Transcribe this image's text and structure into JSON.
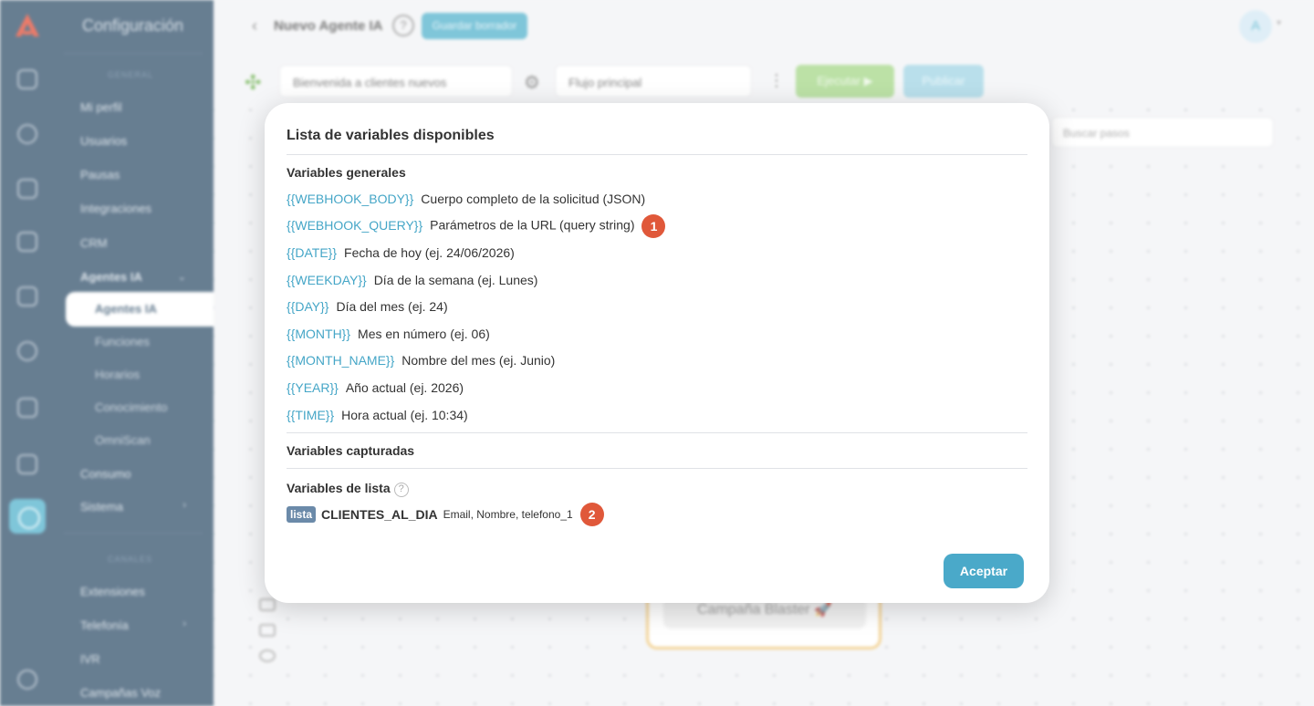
{
  "sidebar": {
    "title": "Configuración",
    "section_general": "GENERAL",
    "items": [
      "Mi perfil",
      "Usuarios",
      "Pausas",
      "Integraciones",
      "CRM"
    ],
    "agents_group": "Agentes IA",
    "agents_sub": [
      "Agentes IA",
      "Funciones",
      "Horarios",
      "Conocimiento",
      "OmniScan"
    ],
    "after_items": [
      "Consumo",
      "Sistema"
    ],
    "section_channels": "CANALES",
    "channel_items": [
      "Extensiones",
      "Telefonía",
      "IVR",
      "Campañas Voz"
    ]
  },
  "header": {
    "title": "Nuevo Agente IA",
    "help": "?",
    "draft_button": "Guardar borrador",
    "avatar": "A"
  },
  "toolbar": {
    "flow_name": "Bienvenida a clientes nuevos",
    "flow_select": "Flujo principal",
    "run_button": "Ejecutar ▶",
    "publish_button": "Publicar",
    "search_placeholder": "Buscar pasos"
  },
  "canvas": {
    "node_label": "Campaña Blaster 🚀"
  },
  "modal": {
    "title": "Lista de variables disponibles",
    "section_general": "Variables generales",
    "variables": [
      {
        "token": "{{WEBHOOK_BODY}}",
        "desc": "Cuerpo completo de la solicitud (JSON)"
      },
      {
        "token": "{{WEBHOOK_QUERY}}",
        "desc": "Parámetros de la URL (query string)"
      },
      {
        "token": "{{DATE}}",
        "desc": "Fecha de hoy (ej. 24/06/2026)"
      },
      {
        "token": "{{WEEKDAY}}",
        "desc": "Día de la semana (ej. Lunes)"
      },
      {
        "token": "{{DAY}}",
        "desc": "Día del mes (ej. 24)"
      },
      {
        "token": "{{MONTH}}",
        "desc": "Mes en número (ej. 06)"
      },
      {
        "token": "{{MONTH_NAME}}",
        "desc": "Nombre del mes (ej. Junio)"
      },
      {
        "token": "{{YEAR}}",
        "desc": "Año actual (ej. 2026)"
      },
      {
        "token": "{{TIME}}",
        "desc": "Hora actual (ej. 10:34)"
      }
    ],
    "badge_1": "1",
    "section_captured": "Variables capturadas",
    "section_list": "Variables de lista",
    "list_help": "?",
    "list": {
      "tag": "lista",
      "name": "CLIENTES_AL_DIA",
      "fields": "Email, Nombre, telefono_1"
    },
    "badge_2": "2",
    "accept_button": "Aceptar"
  },
  "colors": {
    "sidebar_bg": "#3d5a73",
    "accent": "#4aa9c9",
    "token": "#45a6c7",
    "badge": "#e0583a",
    "run": "#a9d98e"
  }
}
